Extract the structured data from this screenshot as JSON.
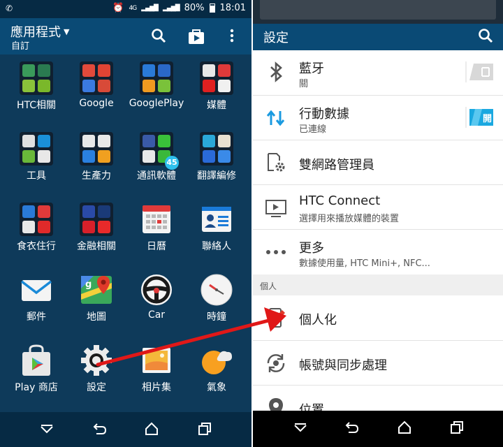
{
  "left_phone": {
    "status_bar": {
      "left_icon": "whatsapp-icon",
      "battery": "80%",
      "time": "18:01",
      "signal": "4G"
    },
    "app_bar": {
      "title": "應用程式",
      "subtitle": "自訂"
    },
    "apps": [
      {
        "label": "HTC相關"
      },
      {
        "label": "Google"
      },
      {
        "label": "GooglePlay"
      },
      {
        "label": "媒體"
      },
      {
        "label": "工具"
      },
      {
        "label": "生產力"
      },
      {
        "label": "通訊軟體",
        "badge": "45"
      },
      {
        "label": "翻譯編修"
      },
      {
        "label": "食衣住行"
      },
      {
        "label": "金融相關"
      },
      {
        "label": "日曆"
      },
      {
        "label": "聯絡人"
      },
      {
        "label": "郵件"
      },
      {
        "label": "地圖"
      },
      {
        "label": "Car"
      },
      {
        "label": "時鐘"
      },
      {
        "label": "Play 商店"
      },
      {
        "label": "設定"
      },
      {
        "label": "相片集"
      },
      {
        "label": "氣象"
      }
    ]
  },
  "right_phone": {
    "title": "設定",
    "section_personal": "個人",
    "rows": [
      {
        "title": "藍牙",
        "subtitle": "關",
        "toggle": "off"
      },
      {
        "title": "行動數據",
        "subtitle": "已連線",
        "toggle": "開"
      },
      {
        "title": "雙網路管理員"
      },
      {
        "title": "HTC Connect",
        "subtitle": "選擇用來播放媒體的裝置"
      },
      {
        "title": "更多",
        "subtitle": "數據使用量, HTC Mini+, NFC..."
      },
      {
        "title": "個人化"
      },
      {
        "title": "帳號與同步處理"
      },
      {
        "title": "位置"
      }
    ]
  },
  "colors": {
    "drawer_bg": "#0e3a5a",
    "app_bar": "#0a4a75",
    "accent_blue": "#1aa0e0",
    "annotation_red": "#e01818"
  }
}
